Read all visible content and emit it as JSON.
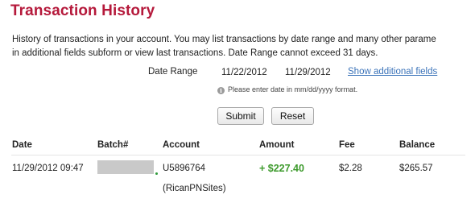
{
  "page": {
    "title": "Transaction History",
    "intro_line1": "History of transactions in your account. You may list transactions by date range and many other parame",
    "intro_line2": "in additional fields subform or view last transactions. Date Range cannot exceed 31 days."
  },
  "filters": {
    "date_range_label": "Date Range",
    "date_from": "11/22/2012",
    "date_to": "11/29/2012",
    "show_additional_fields": "Show additional fields",
    "hint": "Please enter date in mm/dd/yyyy format.",
    "info_icon": "info-icon"
  },
  "actions": {
    "submit_label": "Submit",
    "reset_label": "Reset"
  },
  "table": {
    "headers": {
      "date": "Date",
      "batch": "Batch#",
      "account": "Account",
      "amount": "Amount",
      "fee": "Fee",
      "balance": "Balance"
    },
    "rows": [
      {
        "date": "11/29/2012 09:47",
        "batch": "",
        "account": "U5896764",
        "account_name": "(RicanPNSites)",
        "amount": "+ $227.40",
        "fee": "$2.28",
        "balance": "$265.57"
      }
    ]
  },
  "colors": {
    "title": "#b5193b",
    "link": "#3b73b9",
    "amount_positive": "#3d9a2c"
  }
}
